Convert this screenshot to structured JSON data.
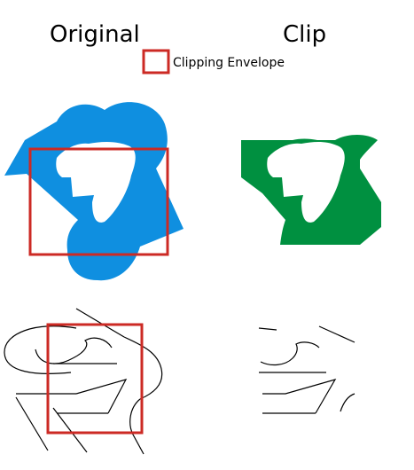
{
  "titles": {
    "original": "Original",
    "clip": "Clip"
  },
  "legend": {
    "label": "Clipping Envelope",
    "swatch_icon": "red-square-outline-icon"
  },
  "colors": {
    "original_polygon": "#0f8fe0",
    "clipped_polygon": "#009040",
    "clip_envelope": "#cc2a24",
    "lines": "#000000",
    "background": "#ffffff"
  }
}
